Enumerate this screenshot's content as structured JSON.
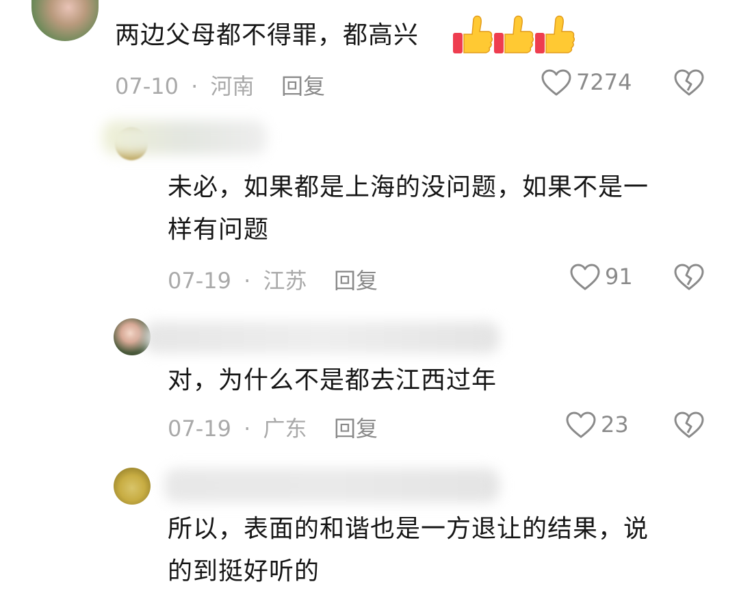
{
  "comments": [
    {
      "text_lines": [
        "两边父母都不得罪，都高兴"
      ],
      "emoji": [
        "thumbs-up",
        "thumbs-up",
        "thumbs-up"
      ],
      "date": "07-10",
      "location": "河南",
      "reply_label": "回复",
      "likes": "7274"
    },
    {
      "text_lines": [
        "未必，如果都是上海的没问题，如果不是一",
        "样有问题"
      ],
      "date": "07-19",
      "location": "江苏",
      "reply_label": "回复",
      "likes": "91"
    },
    {
      "text_lines": [
        "对，为什么不是都去江西过年"
      ],
      "date": "07-19",
      "location": "广东",
      "reply_label": "回复",
      "likes": "23"
    },
    {
      "text_lines": [
        "所以，表面的和谐也是一方退让的结果，说",
        "的到挺好听的"
      ]
    }
  ],
  "separator": "·",
  "icons": {
    "like": "heart-icon",
    "dislike": "broken-heart-icon"
  },
  "colors": {
    "meta": "#a9a9a9",
    "text": "#161616",
    "icon": "#8a8a8a"
  }
}
